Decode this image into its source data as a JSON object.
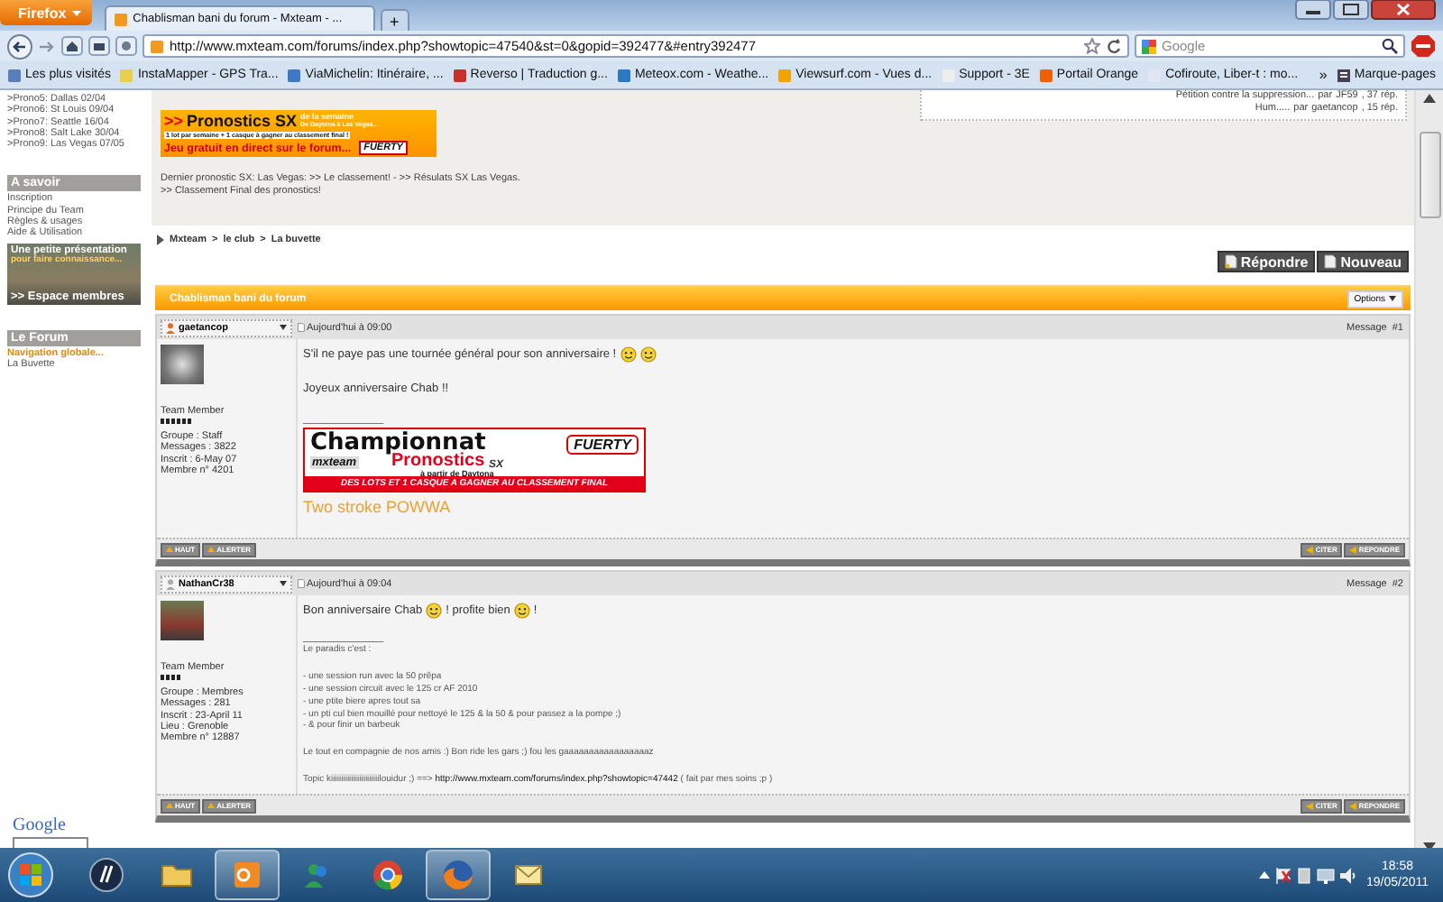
{
  "browser": {
    "menu_button": "Firefox",
    "tabs": [
      {
        "title": "Chablisman bani du forum - Mxteam - ...",
        "selected": true
      }
    ],
    "new_tab": "+",
    "url": "http://www.mxteam.com/forums/index.php?showtopic=47540&st=0&gopid=392477&#entry392477",
    "search": {
      "placeholder": "Google"
    },
    "bookmarks": [
      "Les plus visités",
      "InstaMapper - GPS Tra...",
      "ViaMichelin: Itinéraire, ...",
      "Reverso | Traduction g...",
      "Meteox.com - Weathe...",
      "Viewsurf.com - Vues d...",
      "Support - 3E",
      "Portail Orange",
      "Cofiroute, Liber-t : mo..."
    ],
    "bookmarks_more": "»",
    "bookmarks_menu": "Marque-pages"
  },
  "sidebar": {
    "prono_links": [
      ">Prono5: Dallas 02/04",
      ">Prono6: St Louis 09/04",
      ">Prono7: Seattle 16/04",
      ">Prono8: Salt Lake 30/04",
      ">Prono9: Las Vegas 07/05"
    ],
    "a_savoir": {
      "title": "A savoir",
      "links": [
        "Inscription",
        "Principe du Team",
        "Règles & usages",
        "Aide & Utilisation"
      ]
    },
    "banner": {
      "lines": [
        "Une petite présentation",
        "pour faire connaissance...",
        ">> Espace membres"
      ]
    },
    "forum": {
      "title": "Le Forum",
      "links": [
        {
          "label": "Navigation globale...",
          "selected": true
        },
        {
          "label": "La Buvette",
          "selected": false
        }
      ]
    },
    "google_logo": "Google"
  },
  "header": {
    "latest_topics": [
      {
        "topic": "Pétition contre la suppression...",
        "by": "par",
        "author": "JF59",
        "replies": ", 37 rép."
      },
      {
        "topic": "Hum.....",
        "by": "par",
        "author": "gaetancop",
        "replies": ", 15 rép."
      }
    ],
    "pronostics_banner": {
      "arrows": ">>",
      "title": "Pronostics SX",
      "suffix": "de la semaine",
      "subtitle": "De Daytona à Las Vegas...",
      "line_1": "1 lot par semaine + 1 casque à gagner au classement final !",
      "line_2": "Jeu gratuit en direct sur le forum...",
      "logo": "FUERTY"
    },
    "note": {
      "prefix": "Dernier pronostic SX: Las Vegas:",
      "links": [
        ">> Le classement!",
        ">> Résulats SX Las Vegas."
      ],
      "separator": "-",
      "final_link": ">> Classement Final des pronostics!"
    },
    "breadcrumb": [
      "Mxteam",
      "le club",
      "La buvette"
    ],
    "breadcrumb_separator": ">",
    "buttons": [
      "Répondre",
      "Nouveau"
    ],
    "topic_title": "Chablisman bani du forum",
    "options": "Options"
  },
  "posts": [
    {
      "author": "gaetancop",
      "date": "Aujourd'hui à 09:00",
      "number_label": "Message",
      "number": "#1",
      "rank": "Team Member",
      "stars": 6,
      "info": [
        "Groupe : Staff",
        "Messages : 3822",
        "Inscrit : 6-May 07",
        "Membre n° 4201"
      ],
      "blocks": [
        {
          "kind": "para",
          "parts": [
            {
              "kind": "text",
              "text": "S'il ne paye pas une tournée général pour son anniversaire !"
            },
            {
              "kind": "smiley"
            },
            {
              "kind": "smiley"
            }
          ]
        },
        {
          "kind": "space"
        },
        {
          "kind": "para",
          "parts": [
            {
              "kind": "text",
              "text": "Joyeux anniversaire Chab !!"
            }
          ]
        },
        {
          "kind": "space"
        },
        {
          "kind": "rule",
          "text": "________________"
        },
        {
          "kind": "banner",
          "title": "Championnat",
          "brand": "mxteam",
          "subtitle": "Pronostics",
          "tag": "SX",
          "note": "à partir de Daytona",
          "logo": "FUERTY",
          "strip": "DES LOTS ET 1 CASQUE A GAGNER AU CLASSEMENT FINAL"
        },
        {
          "kind": "signature",
          "text": "Two stroke POWWA"
        }
      ],
      "footer_left": [
        "HAUT",
        "ALERTER"
      ],
      "footer_right": [
        "CITER",
        "REPONDRE"
      ]
    },
    {
      "author": "NathanCr38",
      "date": "Aujourd'hui à 09:04",
      "number_label": "Message",
      "number": "#2",
      "rank": "Team Member",
      "stars": 4,
      "info": [
        "Groupe : Membres",
        "Messages : 281",
        "Inscrit : 23-April 11",
        "Lieu : Grenoble",
        "Membre n° 12887"
      ],
      "blocks": [
        {
          "kind": "para",
          "parts": [
            {
              "kind": "text",
              "text": "Bon anniversaire Chab"
            },
            {
              "kind": "smiley"
            },
            {
              "kind": "text",
              "text": "! profite bien"
            },
            {
              "kind": "smiley"
            },
            {
              "kind": "text",
              "text": "!"
            }
          ]
        },
        {
          "kind": "space"
        },
        {
          "kind": "rule",
          "text": "________________"
        },
        {
          "kind": "small",
          "text": "Le paradis c'est :"
        },
        {
          "kind": "space"
        },
        {
          "kind": "small",
          "text": "- une session run avec la 50 prêpa"
        },
        {
          "kind": "small",
          "text": "- une session circuit avec le 125 cr AF 2010"
        },
        {
          "kind": "small",
          "text": "- une ptite biere apres tout sa"
        },
        {
          "kind": "small",
          "text": "- un pti cul bien mouillé pour nettoyé le 125 & la 50 & pour passez a la pompe ;)"
        },
        {
          "kind": "small",
          "text": "- & pour finir un barbeuk"
        },
        {
          "kind": "space"
        },
        {
          "kind": "small",
          "text": "Le tout en compagnie de nos amis :) Bon ride les gars ;) fou les gaaaaaaaaaaaaaaaaaz"
        },
        {
          "kind": "space"
        },
        {
          "kind": "link_line",
          "before": "Topic kiiiiiiiiiiiiiiiiiiiiiiiilouidur ;) ==>",
          "link": "http://www.mxteam.com/forums/index.php?showtopic=47442",
          "after": "( fait par mes soins ;p )"
        }
      ],
      "footer_left": [
        "HAUT",
        "ALERTER"
      ],
      "footer_right": [
        "CITER",
        "REPONDRE"
      ]
    }
  ],
  "taskbar": {
    "apps": [
      {
        "kind": "hp",
        "selected": false
      },
      {
        "kind": "folder",
        "selected": false
      },
      {
        "kind": "outlook",
        "selected": true
      },
      {
        "kind": "messenger",
        "selected": false
      },
      {
        "kind": "chrome",
        "selected": false
      },
      {
        "kind": "firefox",
        "selected": true
      },
      {
        "kind": "mail",
        "selected": false
      }
    ],
    "time": "18:58",
    "date": "19/05/2011"
  }
}
